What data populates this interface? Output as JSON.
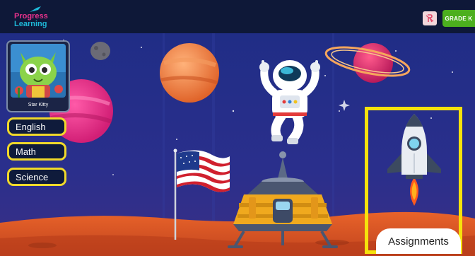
{
  "header": {
    "logo_line1": "Progress",
    "logo_line2": "Learning",
    "grade_label": "GRADE K"
  },
  "avatar": {
    "name": "Star Kitty"
  },
  "subjects": [
    {
      "label": "English"
    },
    {
      "label": "Math"
    },
    {
      "label": "Science"
    }
  ],
  "assignments": {
    "label": "Assignments"
  },
  "colors": {
    "topbar": "#0e1838",
    "highlight": "#f6e20c",
    "grade_button": "#4caf1e",
    "logo_pink": "#e8328c",
    "logo_cyan": "#1eb8d8"
  }
}
